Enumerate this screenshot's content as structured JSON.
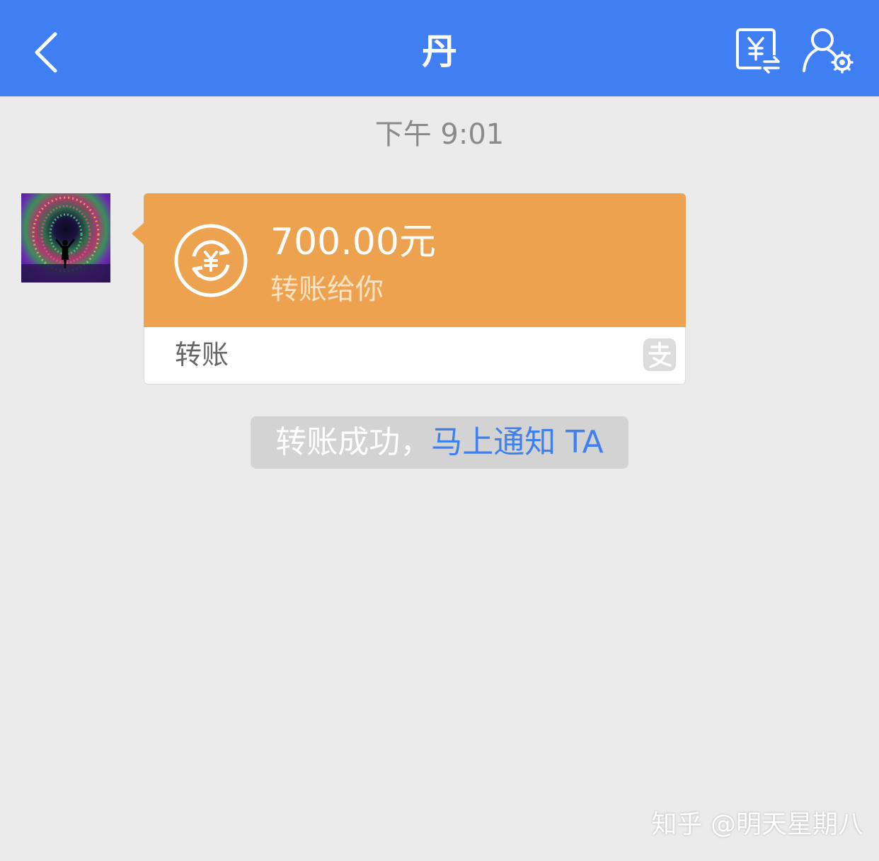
{
  "header": {
    "title": "丹",
    "back_icon": "chevron-left-icon",
    "transfer_icon": "yuan-transfer-icon",
    "profile_icon": "user-settings-icon",
    "background_color": "#3f7ff1"
  },
  "chat": {
    "timestamp": "下午 9:01",
    "message": {
      "amount": "700.00元",
      "subtitle": "转账给你",
      "footer_label": "转账",
      "icon": "yuan-exchange-icon",
      "footer_icon": "alipay-icon",
      "card_color": "#eca24f"
    },
    "notice": {
      "text": "转账成功，",
      "link": "马上通知 TA"
    }
  },
  "watermark": "知乎 @明天星期八"
}
